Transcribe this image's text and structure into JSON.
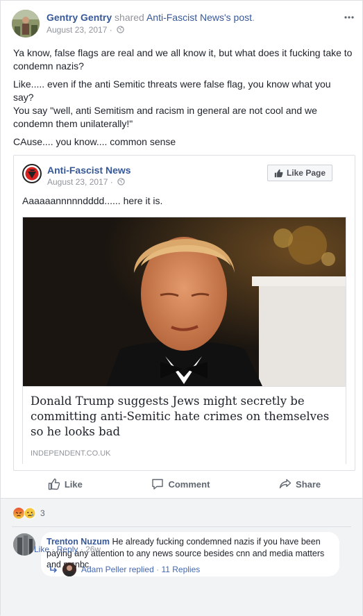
{
  "post": {
    "author": "Gentry Gentry",
    "shared_text": "shared",
    "shared_target": "Anti-Fascist News's post",
    "shared_suffix": ".",
    "date": "August 23, 2017",
    "more_icon": "more-horizontal-icon",
    "paragraphs": [
      "Ya know, false flags are real and we all know it, but what does it fucking take to condemn nazis?",
      "Like..... even if the anti Semitic threats were false flag, you know what you say?",
      "You say \"well, anti Semitism and racism in general are not cool and we condemn them unilaterally!\"",
      "CAuse.... you know.... common sense"
    ]
  },
  "shared": {
    "page_name": "Anti-Fascist News",
    "date": "August 23, 2017",
    "like_page_label": "Like Page",
    "text": "Aaaaaannnnndddd...... here it is.",
    "link": {
      "title": "Donald Trump suggests Jews might secretly be committing anti-Semitic hate crimes on themselves so he looks bad",
      "source": "INDEPENDENT.CO.UK"
    }
  },
  "actions": {
    "like": "Like",
    "comment": "Comment",
    "share": "Share"
  },
  "reactions": {
    "count": "3",
    "icons": [
      "angry-reaction-icon",
      "sad-reaction-icon"
    ]
  },
  "comment": {
    "author": "Trenton Nuzum",
    "text": "He already fucking condemned nazis if you have been paying any attention to any news source besides cnn and media matters and msnbc.",
    "like_label": "Like",
    "reply_label": "Reply",
    "age": "26w",
    "replies": {
      "replier": "Adam Peller",
      "replied_text": "replied",
      "count_text": "11 Replies"
    }
  },
  "colors": {
    "link_blue": "#365899",
    "meta_gray": "#90949c",
    "background": "#e9ebee"
  }
}
